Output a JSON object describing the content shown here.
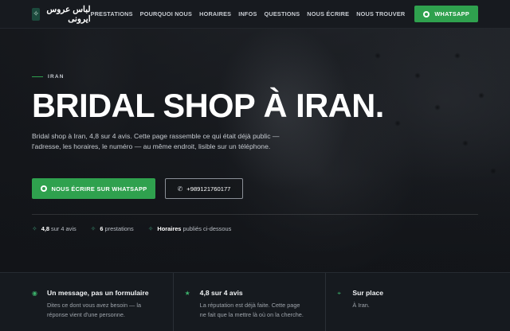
{
  "nav": {
    "brand_name": "لباس عروس ایرونی",
    "links": [
      "PRESTATIONS",
      "POURQUOI NOUS",
      "HORAIRES",
      "INFOS",
      "QUESTIONS",
      "NOUS ÉCRIRE",
      "NOUS TROUVER"
    ],
    "whatsapp_label": "WHATSAPP"
  },
  "hero": {
    "eyebrow": "IRAN",
    "title": "BRIDAL SHOP À IRAN.",
    "lede": "Bridal shop à Iran, 4,8 sur 4 avis. Cette page rassemble ce qui était déjà public — l'adresse, les horaires, le numéro — au même endroit, lisible sur un téléphone.",
    "cta_primary": "NOUS ÉCRIRE SUR WHATSAPP",
    "cta_phone": "+989121760177",
    "stats": [
      {
        "strong": "4,8",
        "text": " sur 4 avis"
      },
      {
        "strong": "6",
        "text": " prestations"
      },
      {
        "strong": "Horaires",
        "text": " publiés ci-dessous"
      }
    ]
  },
  "features": [
    {
      "title": "Un message, pas un formulaire",
      "text": "Dites ce dont vous avez besoin — la réponse vient d'une personne.",
      "icon": "chat-icon"
    },
    {
      "title": "4,8 sur 4 avis",
      "text": "La réputation est déjà faite. Cette page ne fait que la mettre là où on la cherche.",
      "icon": "star-icon"
    },
    {
      "title": "Sur place",
      "text": "À Iran.",
      "icon": "location-pin-icon"
    }
  ],
  "colors": {
    "accent": "#2fa14e",
    "background": "#14171c"
  }
}
